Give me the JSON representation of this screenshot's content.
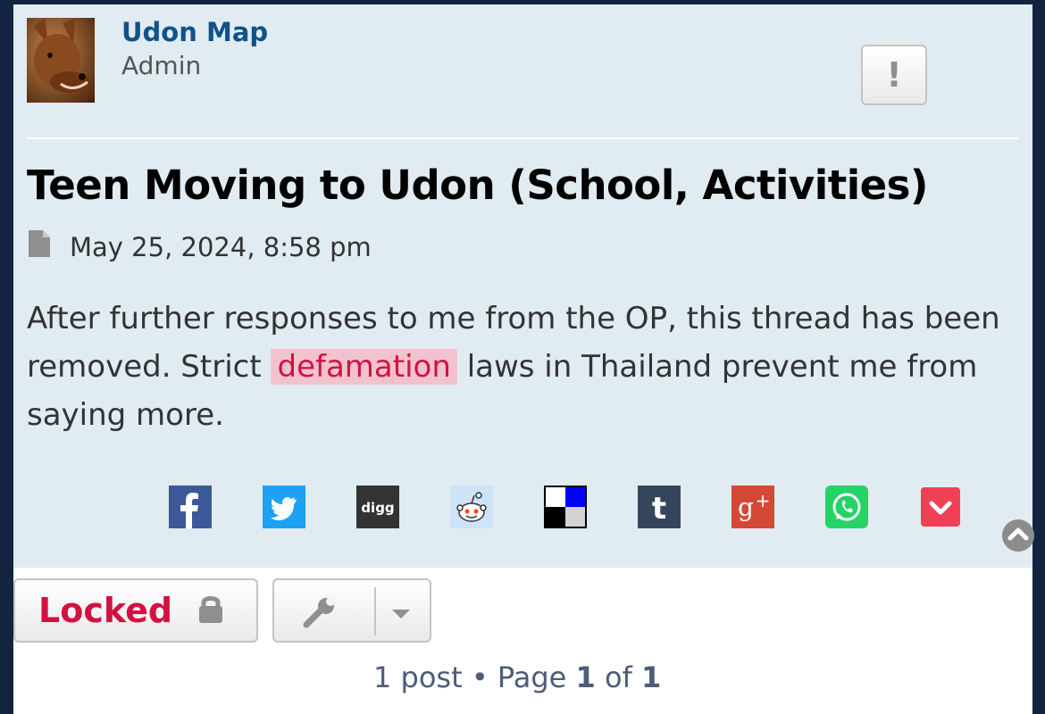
{
  "author": {
    "name": "Udon Map",
    "rank": "Admin"
  },
  "report_button": {
    "label": "!"
  },
  "post": {
    "title": "Teen Moving to Udon (School, Activities)",
    "date": "May 25, 2024, 8:58 pm",
    "body_part1": "After further responses to me from the OP, this thread has been removed. Strict",
    "body_highlight": "defamation",
    "body_part2": "laws in Thailand prevent me from saying more."
  },
  "share": [
    {
      "name": "facebook",
      "icon": "facebook-icon",
      "color": "#3b5998"
    },
    {
      "name": "twitter",
      "icon": "twitter-icon",
      "color": "#1da1f2"
    },
    {
      "name": "digg",
      "icon": "digg-icon",
      "color": "#333333"
    },
    {
      "name": "reddit",
      "icon": "reddit-icon",
      "color": "#cee3f8"
    },
    {
      "name": "delicious",
      "icon": "delicious-icon",
      "color": "#000000"
    },
    {
      "name": "tumblr",
      "icon": "tumblr-icon",
      "color": "#35465c"
    },
    {
      "name": "google-plus",
      "icon": "google-plus-icon",
      "color": "#d34836"
    },
    {
      "name": "whatsapp",
      "icon": "whatsapp-icon",
      "color": "#25d366"
    },
    {
      "name": "pocket",
      "icon": "pocket-icon",
      "color": "#ef4056"
    }
  ],
  "actions": {
    "locked_label": "Locked"
  },
  "pagination": {
    "posts": "1 post",
    "bullet": "•",
    "page_word": "Page",
    "current": "1",
    "of_word": "of",
    "total": "1"
  },
  "colors": {
    "post_bg": "#e1ebf2",
    "author": "#105289",
    "locked": "#d31141",
    "highlight_bg": "#f2c3cf",
    "page_bg": "#12243f"
  }
}
